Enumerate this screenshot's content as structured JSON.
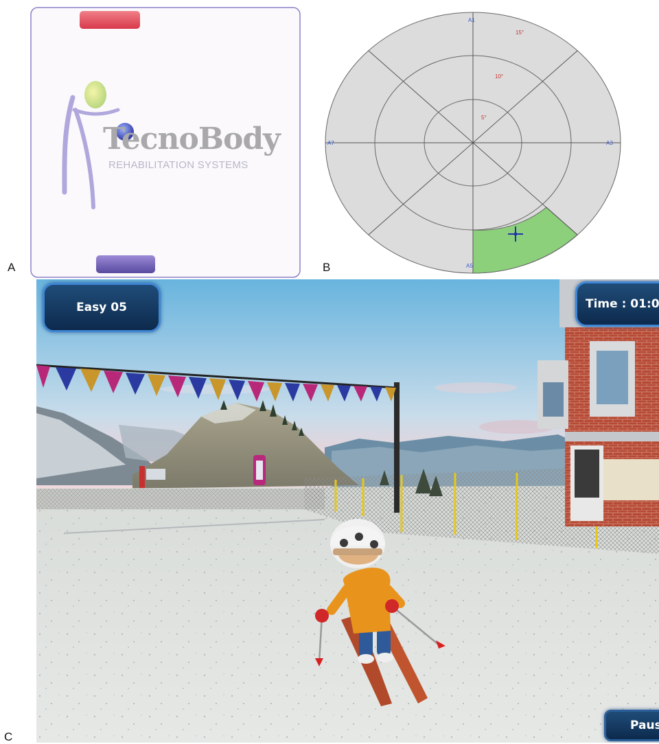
{
  "panels": {
    "a": {
      "letter": "A",
      "brand": {
        "name": "TecnoBody",
        "tagline": "REHABILITATION SYSTEMS"
      },
      "colors": {
        "top_paddle": "#e8505a",
        "bottom_paddle": "#7763b6",
        "ball": "#4a4fc8",
        "frame": "#8c80c8"
      }
    },
    "b": {
      "letter": "B",
      "axis_labels": {
        "top": "A1",
        "right": "A3",
        "bottom": "A5",
        "left": "A7"
      },
      "ring_labels": [
        "5°",
        "10°",
        "15°"
      ],
      "highlight_color": "#8dd07c"
    },
    "c": {
      "letter": "C",
      "level_label": "Easy 05",
      "time_label": "Time : 01:0",
      "pause_label": "Paus"
    }
  }
}
